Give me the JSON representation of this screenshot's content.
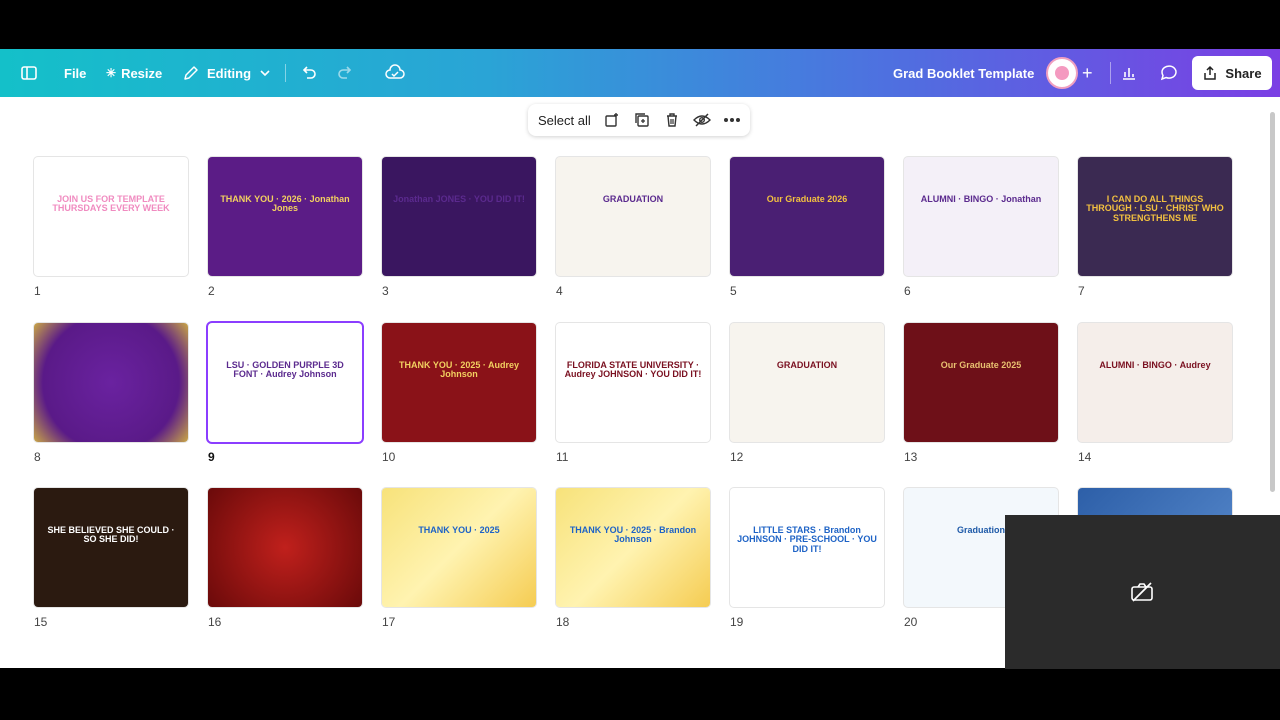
{
  "toolbar": {
    "file_label": "File",
    "resize_label": "Resize",
    "editing_label": "Editing",
    "doc_title": "Grad Booklet Template",
    "share_label": "Share",
    "colors": {
      "gradient_start": "#14c0c9",
      "gradient_end": "#7b3fe4"
    }
  },
  "selection_toolbar": {
    "select_all_label": "Select all",
    "icons": [
      "add-page-icon",
      "duplicate-icon",
      "trash-icon",
      "hide-icon",
      "more-icon"
    ]
  },
  "pages": [
    {
      "number": "1",
      "text": "JOIN US FOR TEMPLATE THURSDAYS EVERY WEEK",
      "bg": "#ffffff",
      "fg": "#f08bc0"
    },
    {
      "number": "2",
      "text": "THANK YOU · 2026 · Jonathan Jones",
      "bg": "#5b1c86",
      "fg": "#f2d060"
    },
    {
      "number": "3",
      "text": "Jonathan JONES · YOU DID IT!",
      "bg": "#3a1660",
      "fg": "#5b2a8e"
    },
    {
      "number": "4",
      "text": "GRADUATION",
      "bg": "#f7f4ee",
      "fg": "#5b2a8e"
    },
    {
      "number": "5",
      "text": "Our Graduate 2026",
      "bg": "#4a1f73",
      "fg": "#f2c040"
    },
    {
      "number": "6",
      "text": "ALUMNI · BINGO · Jonathan",
      "bg": "#f4f0f8",
      "fg": "#5b2a8e"
    },
    {
      "number": "7",
      "text": "I CAN DO ALL THINGS THROUGH · LSU · CHRIST WHO STRENGTHENS ME",
      "bg": "#3b2a52",
      "fg": "#f2c040"
    },
    {
      "number": "8",
      "text": "",
      "bg": "#5a1a88",
      "fg": "#ffffff"
    },
    {
      "number": "9",
      "text": "LSU · GOLDEN PURPLE 3D FONT · Audrey Johnson",
      "bg": "#ffffff",
      "fg": "#5b2a8e"
    },
    {
      "number": "10",
      "text": "THANK YOU · 2025 · Audrey Johnson",
      "bg": "#8a1218",
      "fg": "#f2d060"
    },
    {
      "number": "11",
      "text": "FLORIDA STATE UNIVERSITY · Audrey JOHNSON · YOU DID IT!",
      "bg": "#ffffff",
      "fg": "#7a1020"
    },
    {
      "number": "12",
      "text": "GRADUATION",
      "bg": "#f7f4ee",
      "fg": "#7a1020"
    },
    {
      "number": "13",
      "text": "Our Graduate 2025",
      "bg": "#6e1018",
      "fg": "#e8c070"
    },
    {
      "number": "14",
      "text": "ALUMNI · BINGO · Audrey",
      "bg": "#f5eeea",
      "fg": "#7a1020"
    },
    {
      "number": "15",
      "text": "SHE BELIEVED SHE COULD · SO SHE DID!",
      "bg": "#2b1a10",
      "fg": "#ffffff"
    },
    {
      "number": "16",
      "text": "",
      "bg": "#8f1010",
      "fg": "#ffffff"
    },
    {
      "number": "17",
      "text": "THANK YOU · 2025",
      "bg": "#f7e27a",
      "fg": "#1e63c6"
    },
    {
      "number": "18",
      "text": "THANK YOU · 2025 · Brandon Johnson",
      "bg": "#f7e27a",
      "fg": "#1e63c6"
    },
    {
      "number": "19",
      "text": "LITTLE STARS · Brandon JOHNSON · PRE-SCHOOL · YOU DID IT!",
      "bg": "#ffffff",
      "fg": "#1e63c6"
    },
    {
      "number": "20",
      "text": "Graduation",
      "bg": "#f3f8fc",
      "fg": "#1e5aa8"
    },
    {
      "number": "",
      "text": "",
      "bg": "#3a6fb4",
      "fg": "#ffffff"
    }
  ]
}
